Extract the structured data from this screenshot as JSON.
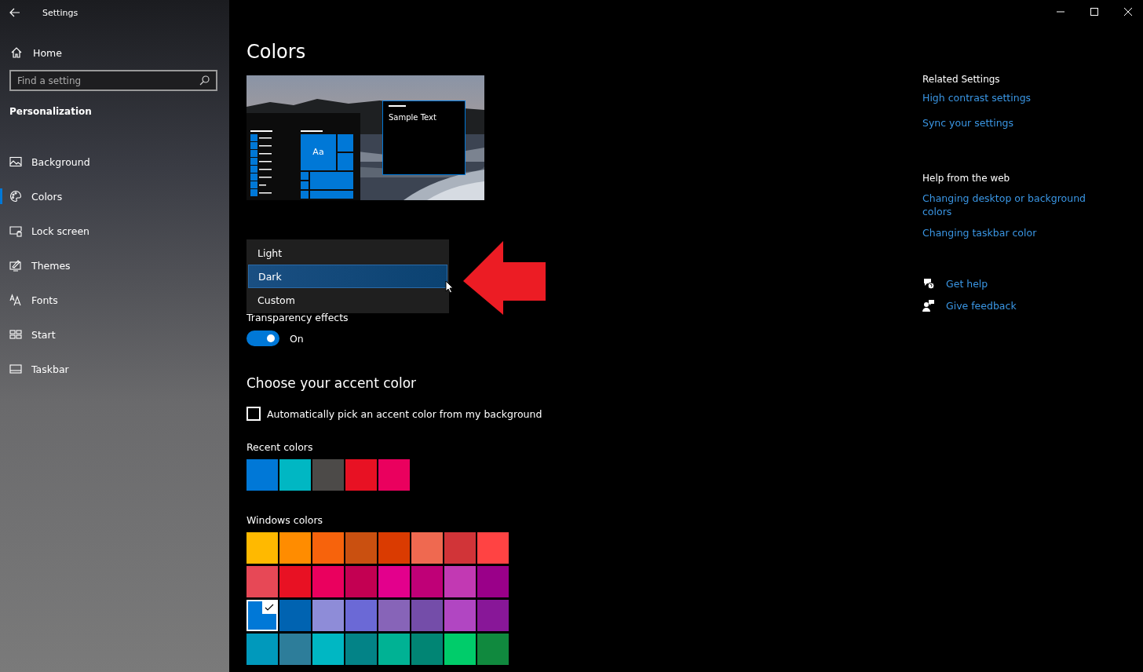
{
  "window": {
    "title": "Settings"
  },
  "sidebar": {
    "home": "Home",
    "search": {
      "placeholder": "Find a setting"
    },
    "section": "Personalization",
    "items": [
      {
        "kind": "background",
        "label": "Background",
        "selected": false
      },
      {
        "kind": "colors",
        "label": "Colors",
        "selected": true
      },
      {
        "kind": "lock",
        "label": "Lock screen",
        "selected": false
      },
      {
        "kind": "themes",
        "label": "Themes",
        "selected": false
      },
      {
        "kind": "fonts",
        "label": "Fonts",
        "selected": false
      },
      {
        "kind": "start",
        "label": "Start",
        "selected": false
      },
      {
        "kind": "taskbar",
        "label": "Taskbar",
        "selected": false
      }
    ]
  },
  "page": {
    "title": "Colors",
    "preview": {
      "tile_text": "Aa",
      "sample_text": "Sample Text"
    },
    "mode_menu": {
      "options": [
        {
          "label": "Light",
          "selected": false
        },
        {
          "label": "Dark",
          "selected": true
        },
        {
          "label": "Custom",
          "selected": false
        }
      ]
    },
    "transparency": {
      "label": "Transparency effects",
      "on": true,
      "state_text": "On"
    },
    "accent": {
      "heading": "Choose your accent color",
      "auto_pick": {
        "label": "Automatically pick an accent color from my background",
        "checked": false
      },
      "recent": {
        "label": "Recent colors",
        "swatches": [
          {
            "color": "#0078d7",
            "selected": false
          },
          {
            "color": "#00b7c3",
            "selected": false
          },
          {
            "color": "#4c4a48",
            "selected": false
          },
          {
            "color": "#e81123",
            "selected": false
          },
          {
            "color": "#ea005e",
            "selected": false
          }
        ]
      },
      "windows": {
        "label": "Windows colors",
        "swatches": [
          {
            "color": "#ffb900",
            "selected": false
          },
          {
            "color": "#ff8c00",
            "selected": false
          },
          {
            "color": "#f7630c",
            "selected": false
          },
          {
            "color": "#ca5010",
            "selected": false
          },
          {
            "color": "#da3b01",
            "selected": false
          },
          {
            "color": "#ef6950",
            "selected": false
          },
          {
            "color": "#d13438",
            "selected": false
          },
          {
            "color": "#ff4343",
            "selected": false
          },
          {
            "color": "#e74856",
            "selected": false
          },
          {
            "color": "#e81123",
            "selected": false
          },
          {
            "color": "#ea005e",
            "selected": false
          },
          {
            "color": "#c30052",
            "selected": false
          },
          {
            "color": "#e3008c",
            "selected": false
          },
          {
            "color": "#bf0077",
            "selected": false
          },
          {
            "color": "#c239b3",
            "selected": false
          },
          {
            "color": "#9a0089",
            "selected": false
          },
          {
            "color": "#0078d7",
            "selected": true
          },
          {
            "color": "#0063b1",
            "selected": false
          },
          {
            "color": "#8e8cd8",
            "selected": false
          },
          {
            "color": "#6b69d6",
            "selected": false
          },
          {
            "color": "#8764b8",
            "selected": false
          },
          {
            "color": "#744da9",
            "selected": false
          },
          {
            "color": "#b146c2",
            "selected": false
          },
          {
            "color": "#881798",
            "selected": false
          },
          {
            "color": "#0099bc",
            "selected": false
          },
          {
            "color": "#2d7d9a",
            "selected": false
          },
          {
            "color": "#00b7c3",
            "selected": false
          },
          {
            "color": "#038387",
            "selected": false
          },
          {
            "color": "#00b294",
            "selected": false
          },
          {
            "color": "#018574",
            "selected": false
          },
          {
            "color": "#00cc6a",
            "selected": false
          },
          {
            "color": "#10893e",
            "selected": false
          }
        ]
      }
    }
  },
  "related": {
    "heading": "Related Settings",
    "links": [
      "High contrast settings",
      "Sync your settings"
    ]
  },
  "help": {
    "heading": "Help from the web",
    "links": [
      "Changing desktop or background colors",
      "Changing taskbar color"
    ]
  },
  "support": [
    {
      "kind": "help",
      "label": "Get help"
    },
    {
      "kind": "feedback",
      "label": "Give feedback"
    }
  ]
}
